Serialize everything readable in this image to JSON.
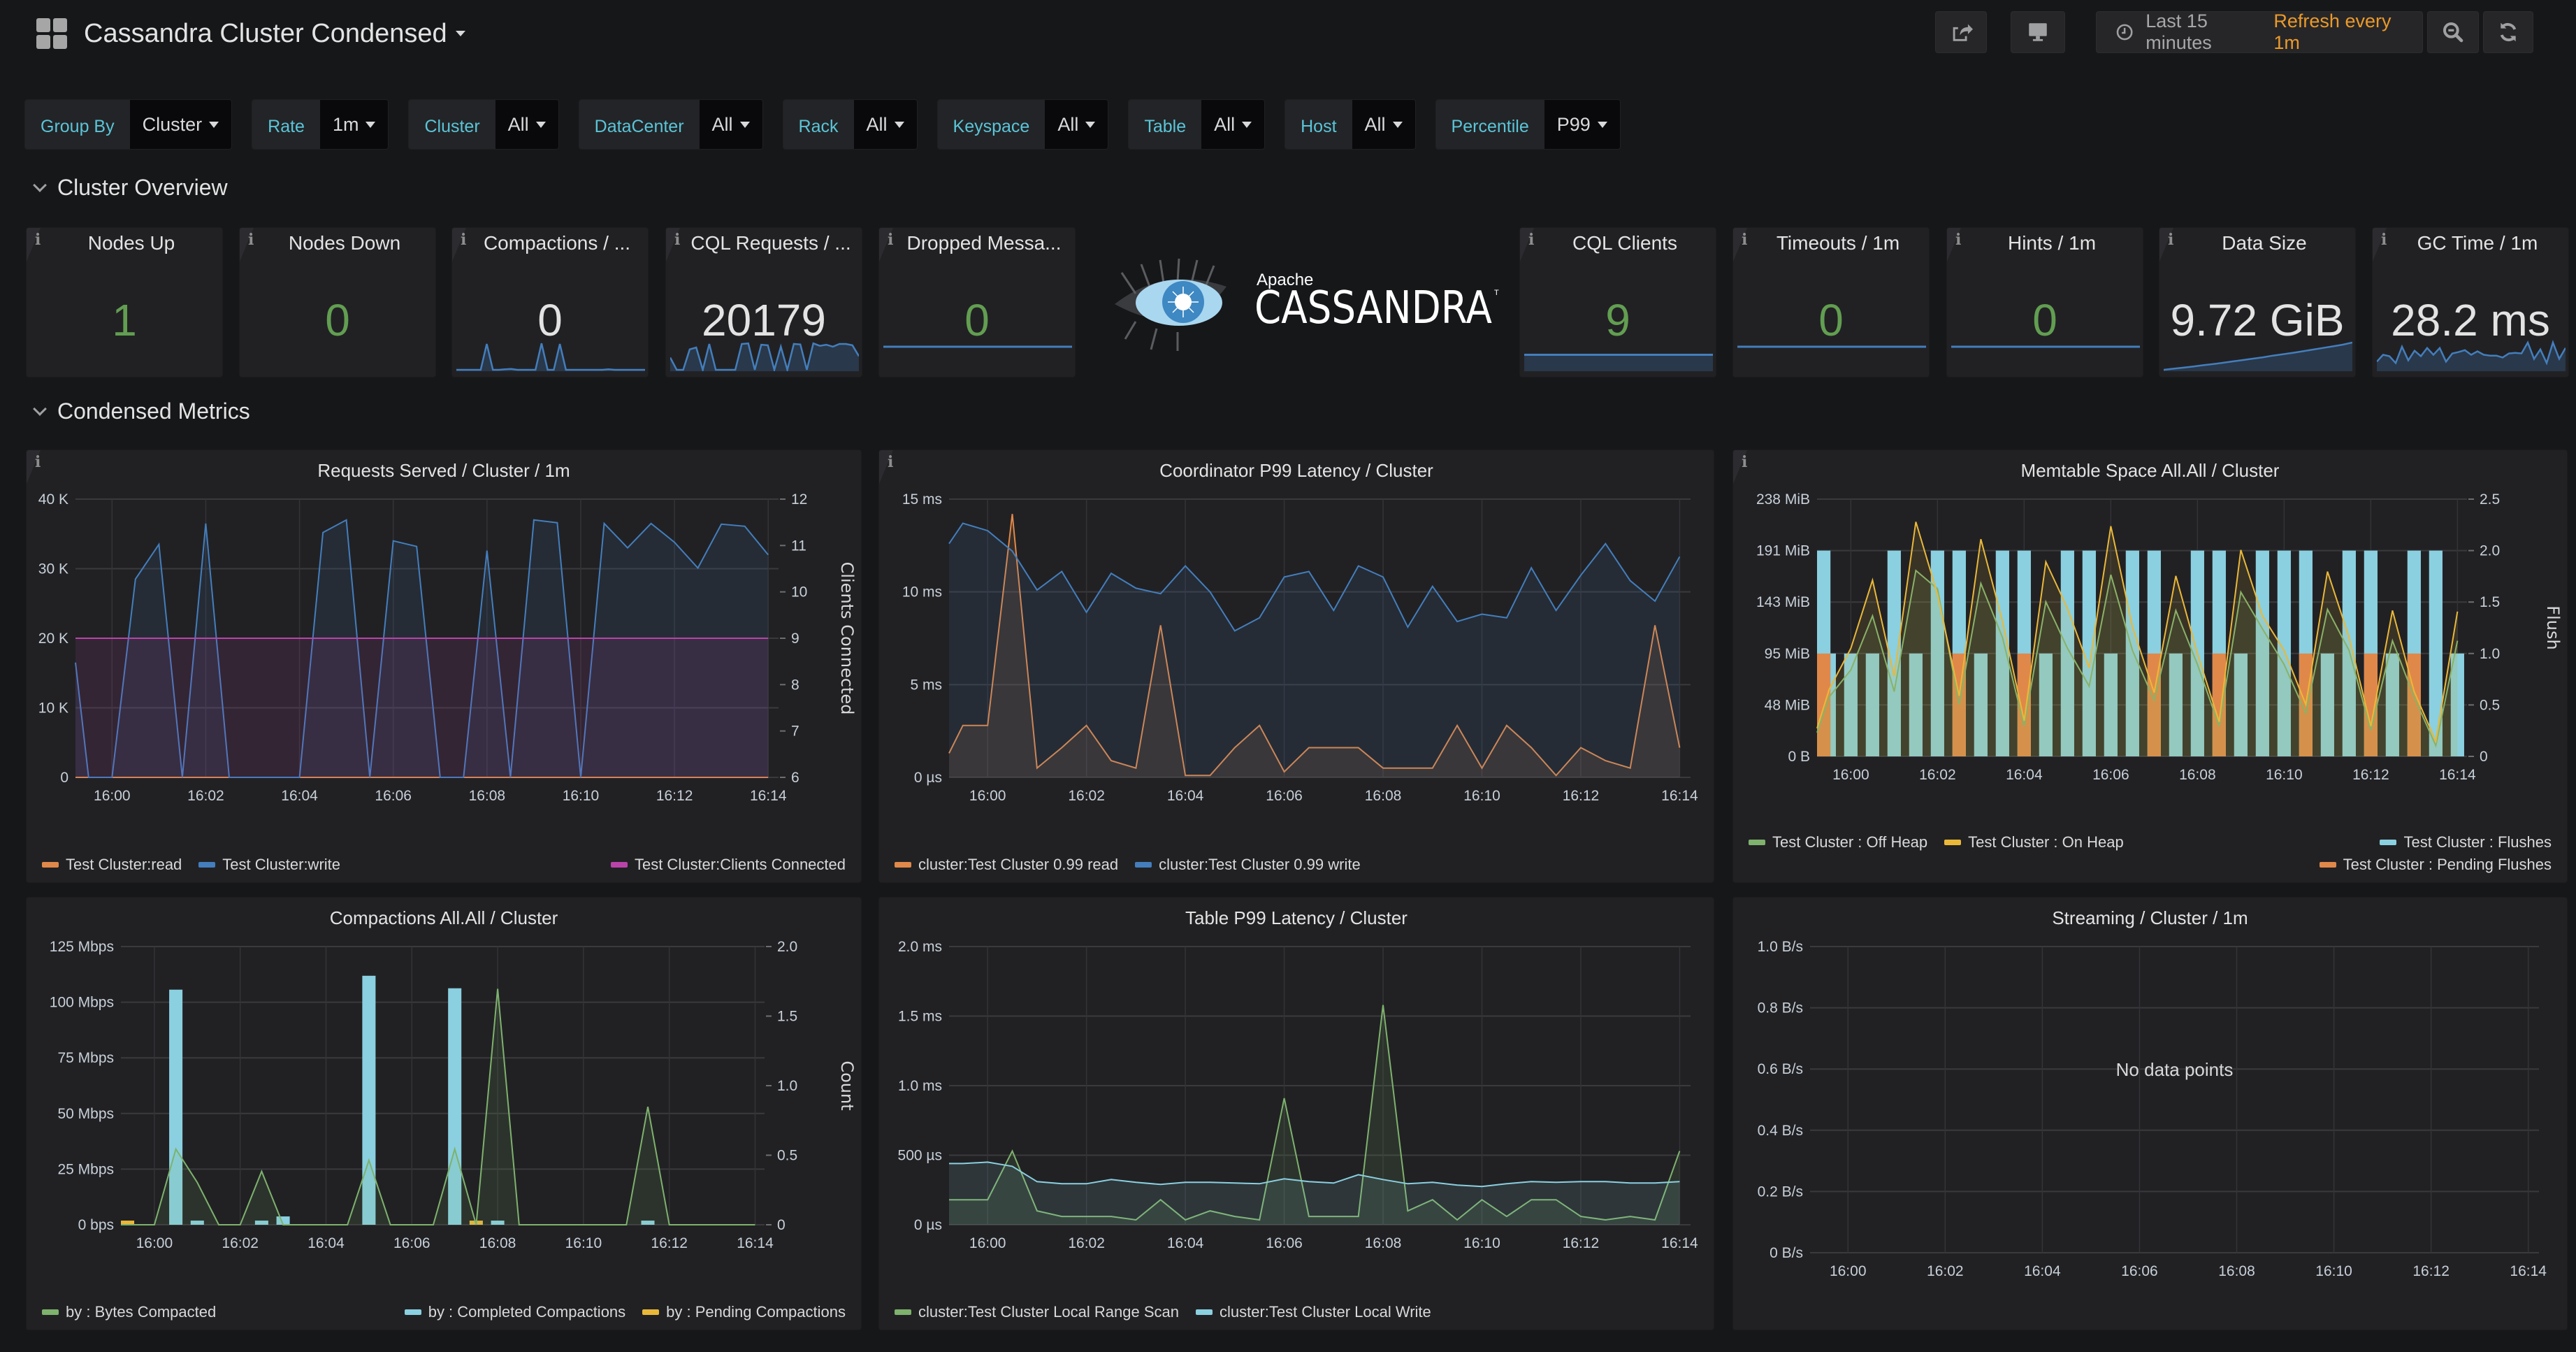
{
  "header": {
    "title": "Cassandra Cluster Condensed",
    "dashboard_icon": "apps-grid-icon",
    "share_icon": "share-icon",
    "tv_icon": "monitor-icon",
    "time_icon": "clock-icon",
    "time_range": "Last 15 minutes",
    "refresh": "Refresh every 1m",
    "zoom_out_icon": "zoom-out-icon",
    "refresh_icon": "refresh-icon"
  },
  "variables": [
    {
      "label": "Group By",
      "value": "Cluster"
    },
    {
      "label": "Rate",
      "value": "1m"
    },
    {
      "label": "Cluster",
      "value": "All"
    },
    {
      "label": "DataCenter",
      "value": "All"
    },
    {
      "label": "Rack",
      "value": "All"
    },
    {
      "label": "Keyspace",
      "value": "All"
    },
    {
      "label": "Table",
      "value": "All"
    },
    {
      "label": "Host",
      "value": "All"
    },
    {
      "label": "Percentile",
      "value": "P99"
    }
  ],
  "rows": {
    "overview": "Cluster Overview",
    "condensed": "Condensed Metrics"
  },
  "colors": {
    "green": "#629e51",
    "blue": "#447ebc",
    "orange": "#e0884a",
    "purple": "#ba43a9",
    "cyan": "#8ad0e0",
    "lightgreen": "#7eb26d",
    "yellow": "#eab839",
    "refresh_orange": "#eb9a2a",
    "var_label": "#5ac5d8"
  },
  "stats": [
    {
      "title": "Nodes Up",
      "value": "1",
      "color": "green",
      "spark": null
    },
    {
      "title": "Nodes Down",
      "value": "0",
      "color": "green",
      "spark": null
    },
    {
      "title": "Compactions / ...",
      "value": "0",
      "color": "white",
      "spark": [
        0,
        0,
        0,
        0,
        0,
        0.95,
        0,
        0,
        0.02,
        0.03,
        0,
        0,
        0,
        0,
        0.97,
        0,
        0,
        0.95,
        0,
        0,
        0,
        0,
        0,
        0,
        0,
        0.02,
        0,
        0,
        0,
        0,
        0,
        0
      ]
    },
    {
      "title": "CQL Requests / ...",
      "value": "20179",
      "color": "white",
      "spark": [
        0.45,
        0,
        0,
        0.75,
        0.82,
        0,
        0.95,
        0,
        0,
        0,
        0,
        0.95,
        0.97,
        0,
        0.92,
        0.9,
        0,
        0.85,
        0,
        0.95,
        0.93,
        0,
        0.97,
        0.88,
        0.92,
        0.85,
        0.95,
        0.95,
        0.9,
        0.5
      ]
    },
    {
      "title": "Dropped Messa...",
      "value": "0",
      "color": "green",
      "spark": "flat"
    },
    {
      "title": "CQL Clients",
      "value": "9",
      "color": "green",
      "spark": "flat-fill"
    },
    {
      "title": "Timeouts / 1m",
      "value": "0",
      "color": "green",
      "spark": "flat"
    },
    {
      "title": "Hints / 1m",
      "value": "0",
      "color": "green",
      "spark": "flat"
    },
    {
      "title": "Data Size",
      "value": "9.72 GiB",
      "color": "white",
      "spark": [
        0,
        0.04,
        0.08,
        0.12,
        0.17,
        0.21,
        0.26,
        0.31,
        0.36,
        0.41,
        0.46,
        0.52,
        0.57,
        0.62,
        0.68,
        0.74,
        0.8,
        0.86,
        0.92,
        1
      ]
    },
    {
      "title": "GC Time / 1m",
      "value": "28.2 ms",
      "color": "white",
      "spark": [
        0.3,
        0.55,
        0.5,
        0.25,
        0.85,
        0.35,
        0.7,
        0.5,
        0.8,
        0.55,
        0.8,
        0.3,
        0.6,
        0.65,
        0.72,
        0.55,
        0.68,
        0.55,
        0.52,
        0.52,
        0.45,
        0.6,
        0.62,
        0.6,
        1.0,
        0.4,
        0.75,
        0.25,
        1.0,
        0.4,
        0.8
      ]
    }
  ],
  "logo": {
    "small": "Apache",
    "big": "CASSANDRA",
    "tm": "TM"
  },
  "time_ticks": [
    "16:00",
    "16:02",
    "16:04",
    "16:06",
    "16:08",
    "16:10",
    "16:12",
    "16:14"
  ],
  "chart_data": [
    {
      "id": "requests",
      "type": "line",
      "title": "Requests Served / Cluster / 1m",
      "x_range": [
        "15:59:13",
        "16:14:13"
      ],
      "ylabel": "",
      "y_ticks": [
        "0",
        "10 K",
        "20 K",
        "30 K",
        "40 K"
      ],
      "ylim": [
        0,
        40000
      ],
      "y2label": "Clients Connected",
      "y2_ticks": [
        "6",
        "7",
        "8",
        "9",
        "10",
        "11",
        "12"
      ],
      "y2lim": [
        6,
        12
      ],
      "x": [
        -0.78,
        -0.5,
        0,
        0.5,
        1,
        1.5,
        2,
        2.5,
        3,
        3.5,
        4,
        4.5,
        5,
        5.5,
        6,
        6.5,
        7,
        7.5,
        8,
        8.5,
        9,
        9.5,
        10,
        10.5,
        11,
        11.5,
        12,
        12.5,
        13,
        13.5,
        14
      ],
      "series": [
        {
          "name": "Test Cluster:read",
          "color": "#e0884a",
          "axis": "left",
          "values": [
            0,
            0,
            0,
            0,
            0,
            0,
            0,
            0,
            0,
            0,
            0,
            0,
            0,
            0,
            0,
            0,
            0,
            0,
            0,
            0,
            0,
            0,
            0,
            0,
            0,
            0,
            0,
            0,
            0,
            0,
            0
          ]
        },
        {
          "name": "Test Cluster:write",
          "color": "#447ebc",
          "axis": "left",
          "values": [
            16500,
            0,
            0,
            28500,
            33500,
            0,
            36500,
            0,
            0,
            0,
            0,
            35200,
            37000,
            0,
            34000,
            33200,
            0,
            0,
            32600,
            0,
            37000,
            36600,
            0,
            36500,
            33000,
            36500,
            33800,
            30100,
            36400,
            36100,
            32000
          ]
        },
        {
          "name": "Test Cluster:Clients Connected",
          "color": "#ba43a9",
          "axis": "right",
          "values": [
            9,
            9,
            9,
            9,
            9,
            9,
            9,
            9,
            9,
            9,
            9,
            9,
            9,
            9,
            9,
            9,
            9,
            9,
            9,
            9,
            9,
            9,
            9,
            9,
            9,
            9,
            9,
            9,
            9,
            9,
            9
          ]
        }
      ],
      "legend": "bottom"
    },
    {
      "id": "coord_latency",
      "type": "line",
      "title": "Coordinator P99 Latency / Cluster",
      "y_ticks": [
        "0 µs",
        "5 ms",
        "10 ms",
        "15 ms"
      ],
      "ylim": [
        0,
        15
      ],
      "y_unit": "ms",
      "x": [
        -0.78,
        -0.5,
        0,
        0.5,
        1,
        1.5,
        2,
        2.5,
        3,
        3.5,
        4,
        4.5,
        5,
        5.5,
        6,
        6.5,
        7,
        7.5,
        8,
        8.5,
        9,
        9.5,
        10,
        10.5,
        11,
        11.5,
        12,
        12.5,
        13,
        13.5,
        14
      ],
      "series": [
        {
          "name": "cluster:Test Cluster 0.99 read",
          "color": "#e0884a",
          "values": [
            1.3,
            2.8,
            2.8,
            14.2,
            0.5,
            1.6,
            2.8,
            0.9,
            0.5,
            8.2,
            0.1,
            0.1,
            1.6,
            2.8,
            0.3,
            1.6,
            1.6,
            1.6,
            0.5,
            0.5,
            0.5,
            2.8,
            0.5,
            2.8,
            1.6,
            0.1,
            1.6,
            0.9,
            0.5,
            8.2,
            1.6
          ]
        },
        {
          "name": "cluster:Test Cluster 0.99 write",
          "color": "#447ebc",
          "values": [
            12.6,
            13.7,
            13.3,
            12.2,
            10.1,
            11.1,
            8.9,
            11.0,
            10.2,
            9.9,
            11.4,
            10.0,
            7.9,
            8.6,
            10.8,
            11.1,
            9.0,
            11.4,
            10.8,
            8.1,
            10.3,
            8.4,
            8.8,
            8.6,
            11.3,
            9.0,
            10.9,
            12.6,
            10.6,
            9.5,
            11.9
          ]
        }
      ],
      "legend": "bottom"
    },
    {
      "id": "memtable",
      "type": "bar+line",
      "title": "Memtable Space All.All / Cluster",
      "y_ticks": [
        "0 B",
        "48 MiB",
        "95 MiB",
        "143 MiB",
        "191 MiB",
        "238 MiB"
      ],
      "ylim": [
        0,
        238
      ],
      "y_unit": "MiB",
      "y2label": "Flush",
      "y2_ticks": [
        "0",
        "0.5",
        "1.0",
        "1.5",
        "2.0",
        "2.5"
      ],
      "y2lim": [
        0,
        2.5
      ],
      "x": [
        -0.78,
        -0.5,
        0,
        0.5,
        1,
        1.5,
        2,
        2.5,
        3,
        3.5,
        4,
        4.5,
        5,
        5.5,
        6,
        6.5,
        7,
        7.5,
        8,
        8.5,
        9,
        9.5,
        10,
        10.5,
        11,
        11.5,
        12,
        12.5,
        13,
        13.5,
        14
      ],
      "series": [
        {
          "name": "Test Cluster : Off Heap",
          "color": "#7eb26d",
          "type": "line",
          "axis": "left",
          "values": [
            22,
            55,
            80,
            130,
            60,
            172,
            155,
            48,
            160,
            110,
            28,
            143,
            100,
            65,
            168,
            98,
            52,
            135,
            85,
            28,
            152,
            118,
            85,
            40,
            136,
            98,
            24,
            107,
            55,
            10,
            107
          ]
        },
        {
          "name": "Test Cluster : On Heap",
          "color": "#eab839",
          "type": "line",
          "axis": "left",
          "values": [
            26,
            62,
            100,
            163,
            74,
            217,
            150,
            56,
            201,
            125,
            33,
            180,
            137,
            82,
            213,
            120,
            59,
            167,
            95,
            32,
            191,
            130,
            98,
            48,
            171,
            110,
            28,
            135,
            60,
            14,
            134
          ]
        },
        {
          "name": "Test Cluster : Flushes",
          "color": "#8ad0e0",
          "type": "bars",
          "axis": "right",
          "values": [
            2,
            1,
            1,
            1,
            2,
            1,
            2,
            2,
            1,
            2,
            2,
            1,
            2,
            2,
            1,
            2,
            2,
            1,
            2,
            2,
            1,
            2,
            2,
            2,
            1,
            2,
            2,
            1,
            2,
            2,
            1
          ]
        },
        {
          "name": "Test Cluster : Pending Flushes",
          "color": "#e0884a",
          "type": "bars",
          "axis": "right",
          "values": [
            1,
            0,
            0,
            0,
            0,
            0,
            0,
            1,
            0,
            0,
            1,
            0,
            0,
            0,
            0,
            0,
            1,
            0,
            0,
            1,
            0,
            0,
            0,
            1,
            0,
            0,
            1,
            0,
            1,
            0,
            0
          ]
        }
      ],
      "legend": "bottom"
    },
    {
      "id": "compactions",
      "type": "bar+line",
      "title": "Compactions All.All / Cluster",
      "y_ticks": [
        "0 bps",
        "25 Mbps",
        "50 Mbps",
        "75 Mbps",
        "100 Mbps",
        "125 Mbps"
      ],
      "ylim": [
        0,
        125
      ],
      "y_unit": "Mbps",
      "y2label": "Count",
      "y2_ticks": [
        "0",
        "0.5",
        "1.0",
        "1.5",
        "2.0"
      ],
      "y2lim": [
        0,
        2
      ],
      "x": [
        -0.78,
        -0.5,
        0,
        0.5,
        1,
        1.5,
        2,
        2.5,
        3,
        3.5,
        4,
        4.5,
        5,
        5.5,
        6,
        6.5,
        7,
        7.5,
        8,
        8.5,
        9,
        9.5,
        10,
        10.5,
        11,
        11.5,
        12,
        12.5,
        13,
        13.5,
        14
      ],
      "series": [
        {
          "name": "by : Bytes Compacted",
          "color": "#7eb26d",
          "type": "line",
          "axis": "left",
          "values": [
            0,
            0,
            0,
            34,
            19,
            0,
            0,
            24,
            0,
            0,
            0,
            0,
            29,
            0,
            0,
            0,
            34,
            0,
            106,
            0,
            0,
            0,
            0,
            0,
            0,
            53,
            0,
            0,
            0,
            0,
            0
          ]
        },
        {
          "name": "by : Completed Compactions",
          "color": "#8ad0e0",
          "type": "bars",
          "axis": "right",
          "values": [
            0,
            0,
            0,
            1.69,
            0.03,
            0,
            0,
            0.03,
            0.06,
            0,
            0,
            0,
            1.79,
            0,
            0,
            0,
            1.7,
            0,
            0.03,
            0,
            0,
            0,
            0,
            0,
            0,
            0.03,
            0,
            0,
            0,
            0,
            0
          ]
        },
        {
          "name": "by : Pending Compactions",
          "color": "#eab839",
          "type": "bars",
          "axis": "right",
          "values": [
            0.03,
            0,
            0,
            0,
            0,
            0,
            0,
            0,
            0,
            0,
            0,
            0,
            0,
            0,
            0,
            0,
            0,
            0.03,
            0,
            0,
            0,
            0,
            0,
            0,
            0,
            0,
            0,
            0,
            0,
            0,
            0
          ]
        }
      ],
      "legend": "bottom"
    },
    {
      "id": "table_latency",
      "type": "line",
      "title": "Table P99 Latency / Cluster",
      "y_ticks": [
        "0 µs",
        "500 µs",
        "1.0 ms",
        "1.5 ms",
        "2.0 ms"
      ],
      "ylim": [
        0,
        2000
      ],
      "y_unit": "µs",
      "x": [
        -0.78,
        -0.5,
        0,
        0.5,
        1,
        1.5,
        2,
        2.5,
        3,
        3.5,
        4,
        4.5,
        5,
        5.5,
        6,
        6.5,
        7,
        7.5,
        8,
        8.5,
        9,
        9.5,
        10,
        10.5,
        11,
        11.5,
        12,
        12.5,
        13,
        13.5,
        14
      ],
      "series": [
        {
          "name": "cluster:Test Cluster Local Range Scan",
          "color": "#7eb26d",
          "values": [
            180,
            180,
            180,
            530,
            100,
            60,
            60,
            60,
            35,
            180,
            35,
            100,
            60,
            35,
            910,
            60,
            60,
            60,
            1580,
            100,
            180,
            35,
            180,
            60,
            180,
            180,
            60,
            35,
            60,
            35,
            530
          ]
        },
        {
          "name": "cluster:Test Cluster Local Write",
          "color": "#8ad0e0",
          "values": [
            440,
            440,
            450,
            420,
            310,
            295,
            295,
            325,
            305,
            290,
            305,
            305,
            300,
            295,
            330,
            310,
            300,
            360,
            325,
            295,
            305,
            285,
            275,
            295,
            310,
            305,
            310,
            310,
            300,
            300,
            310
          ]
        }
      ],
      "legend": "bottom"
    },
    {
      "id": "streaming",
      "type": "line",
      "title": "Streaming / Cluster / 1m",
      "y_ticks": [
        "0 B/s",
        "0.2 B/s",
        "0.4 B/s",
        "0.6 B/s",
        "0.8 B/s",
        "1.0 B/s"
      ],
      "ylim": [
        0,
        1
      ],
      "series": [],
      "no_data_text": "No data points"
    }
  ]
}
